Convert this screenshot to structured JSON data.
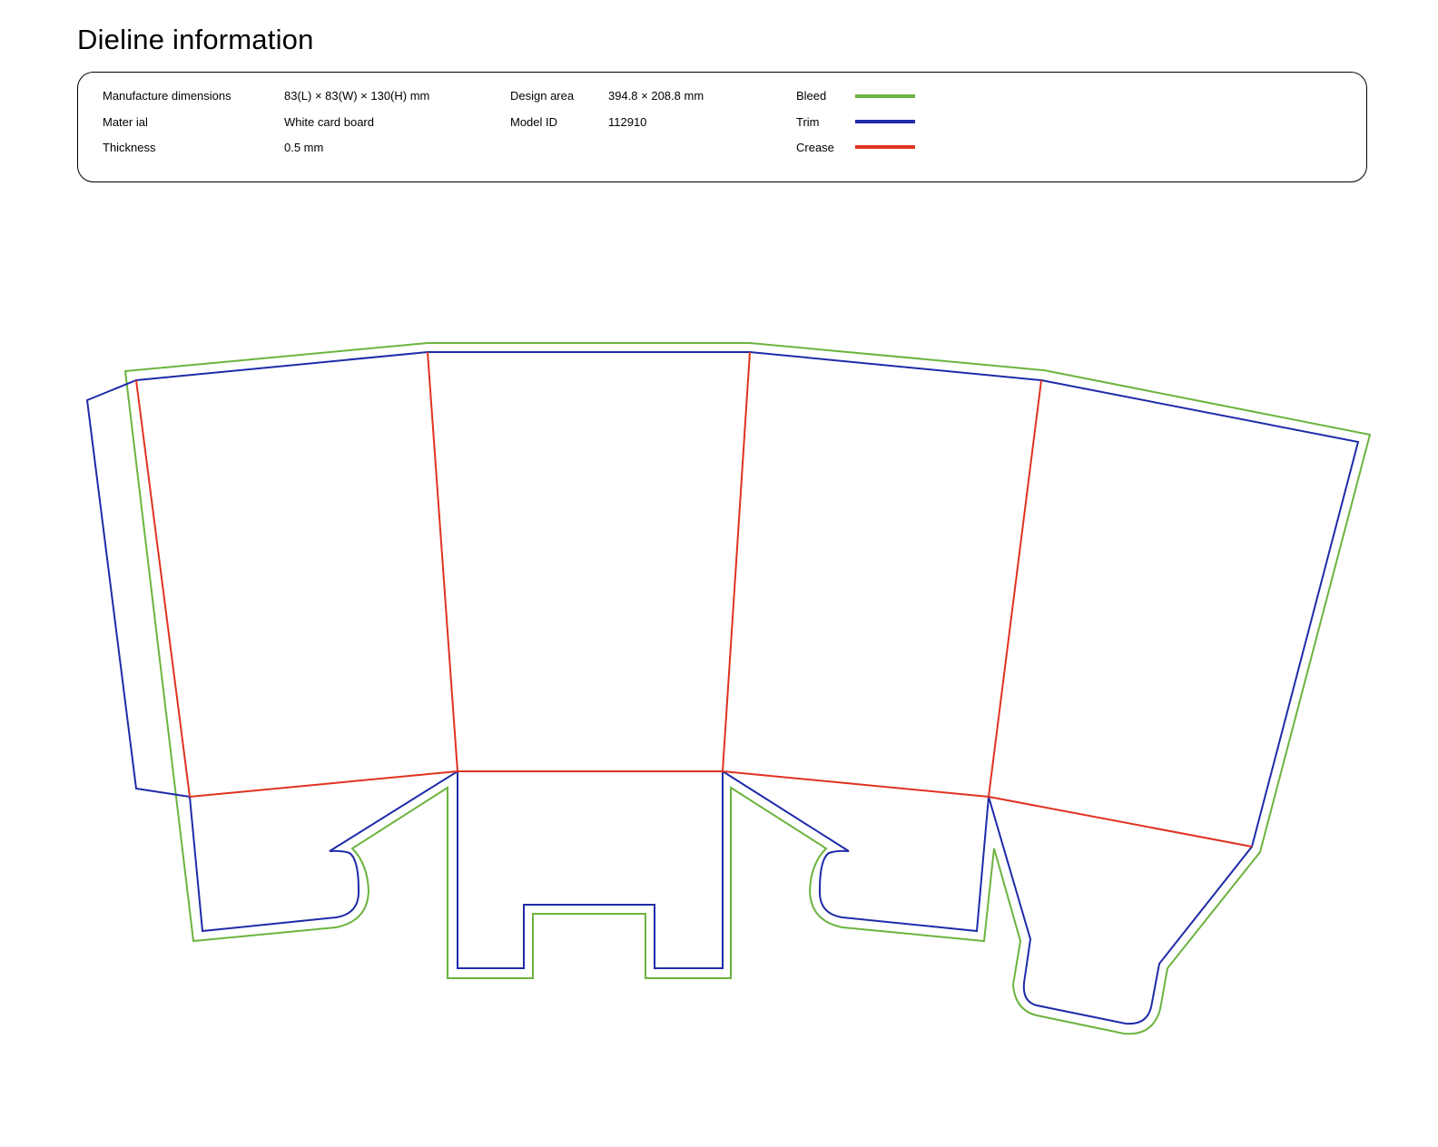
{
  "title": "Dieline information",
  "info": {
    "manufacture_label": "Manufacture dimensions",
    "manufacture_value": "83(L) × 83(W) × 130(H) mm",
    "material_label": "Mater ial",
    "material_value": "White card board",
    "thickness_label": "Thickness",
    "thickness_value": "0.5 mm",
    "design_area_label": "Design area",
    "design_area_value": "394.8 × 208.8 mm",
    "model_id_label": "Model ID",
    "model_id_value": "112910"
  },
  "legend": [
    {
      "label": "Bleed",
      "color": "#6cb33f"
    },
    {
      "label": "Trim",
      "color": "#1f2aa8"
    },
    {
      "label": "Crease",
      "color": "#e0321f"
    }
  ],
  "colors": {
    "bleed": "#6cb33f",
    "trim": "#1f2aa8",
    "crease": "#e0321f"
  }
}
